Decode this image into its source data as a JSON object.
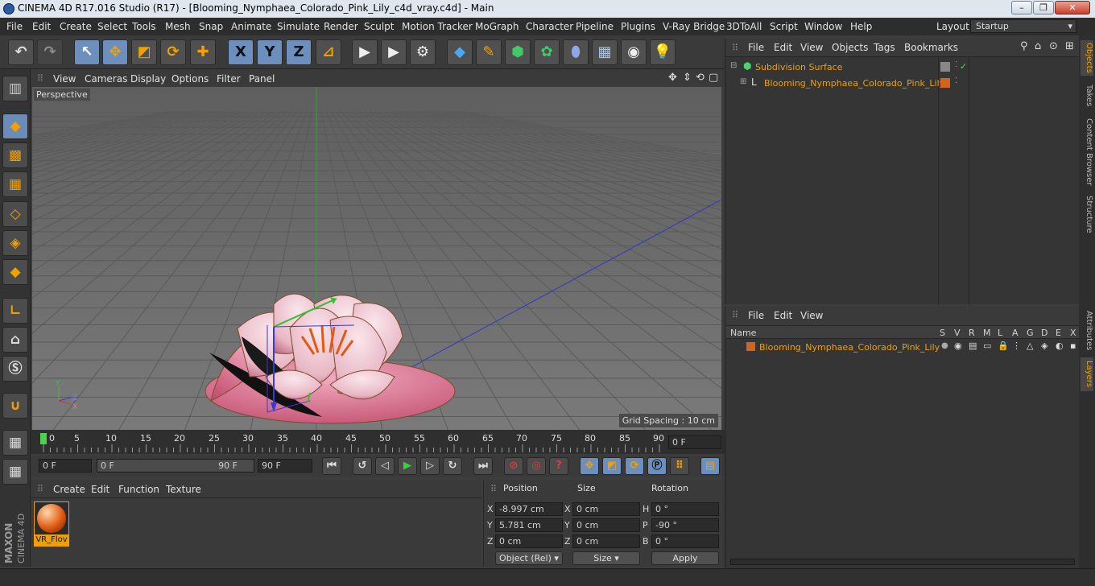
{
  "window": {
    "title": "CINEMA 4D R17.016 Studio (R17) - [Blooming_Nymphaea_Colorado_Pink_Lily_c4d_vray.c4d] - Main",
    "minimize": "–",
    "maximize": "❐",
    "close": "✕"
  },
  "menubar": {
    "items": [
      "File",
      "Edit",
      "Create",
      "Select",
      "Tools",
      "Mesh",
      "Snap",
      "Animate",
      "Simulate",
      "Render",
      "Sculpt",
      "Motion Tracker",
      "MoGraph",
      "Character",
      "Pipeline",
      "Plugins",
      "V-Ray Bridge",
      "3DToAll",
      "Script",
      "Window",
      "Help"
    ],
    "layout_label": "Layout:",
    "layout_value": "Startup"
  },
  "toolbar": {
    "axis_x": "X",
    "axis_y": "Y",
    "axis_z": "Z"
  },
  "viewport": {
    "menu": [
      "View",
      "Cameras",
      "Display",
      "Options",
      "Filter",
      "Panel"
    ],
    "label": "Perspective",
    "grid_spacing": "Grid Spacing : 10 cm",
    "axis_y": "Y",
    "axis_z": "Z",
    "axis_x": "X"
  },
  "timeline": {
    "ticks": [
      "0",
      "5",
      "10",
      "15",
      "20",
      "25",
      "30",
      "35",
      "40",
      "45",
      "50",
      "55",
      "60",
      "65",
      "70",
      "75",
      "80",
      "85",
      "90"
    ],
    "current_frame": "0 F",
    "start_frame": "0 F",
    "range_start": "0 F",
    "range_end": "90 F",
    "end_frame": "90 F"
  },
  "material_manager": {
    "menu": [
      "Create",
      "Edit",
      "Function",
      "Texture"
    ],
    "material_name": "VR_Flov"
  },
  "coordinates": {
    "headers": [
      "Position",
      "Size",
      "Rotation"
    ],
    "pos_x": "-8.997 cm",
    "pos_y": "5.781 cm",
    "pos_z": "0 cm",
    "size_x": "0 cm",
    "size_y": "0 cm",
    "size_z": "0 cm",
    "rot_h": "0 °",
    "rot_p": "-90 °",
    "rot_b": "0 °",
    "labels": [
      "X",
      "Y",
      "Z",
      "X",
      "Y",
      "Z",
      "H",
      "P",
      "B"
    ],
    "mode": "Object (Rel)",
    "size_mode": "Size",
    "apply": "Apply"
  },
  "object_manager": {
    "menu": [
      "File",
      "Edit",
      "View",
      "Objects",
      "Tags",
      "Bookmarks"
    ],
    "objects": [
      {
        "name": "Subdivision Surface"
      },
      {
        "name": "Blooming_Nymphaea_Colorado_Pink_Lily"
      }
    ]
  },
  "layer_manager": {
    "menu": [
      "File",
      "Edit",
      "View"
    ],
    "name_header": "Name",
    "column_headers": [
      "S",
      "V",
      "R",
      "M",
      "L",
      "A",
      "G",
      "D",
      "E",
      "X"
    ],
    "layer_name": "Blooming_Nymphaea_Colorado_Pink_Lily"
  },
  "side_tabs": [
    "Objects",
    "Takes",
    "Content Browser",
    "Structure",
    "Attributes",
    "Layers"
  ],
  "brand": {
    "maxon": "MAXON",
    "cinema": "CINEMA 4D"
  },
  "colors": {
    "accent": "#f1a000",
    "selected": "#6d8fbe",
    "object_name": "#f0a000",
    "layer_swatch": "#d2641e"
  }
}
